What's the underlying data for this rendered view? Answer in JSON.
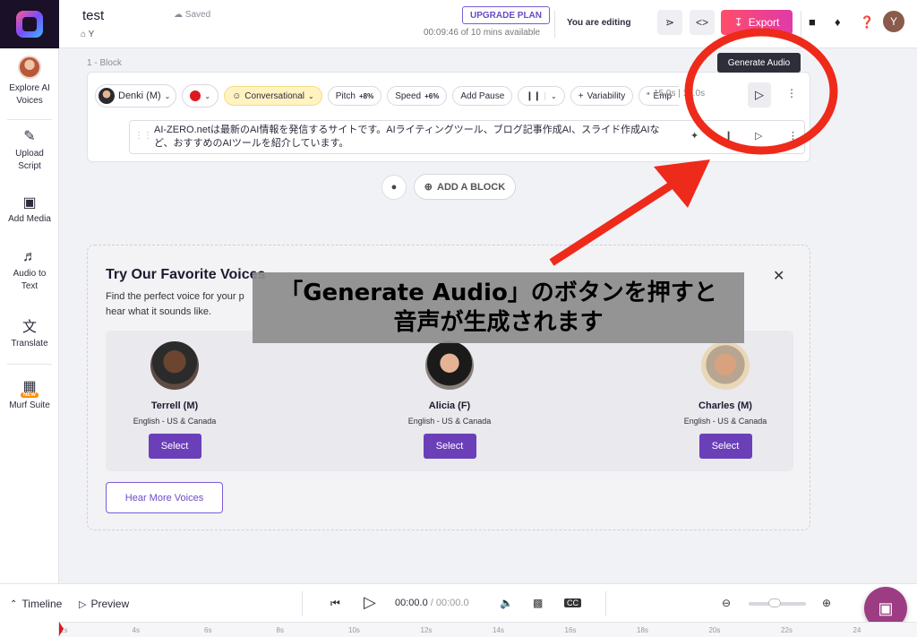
{
  "app": {
    "project_title": "test",
    "saved_status": "Saved",
    "breadcrumb": "Y",
    "upgrade_label": "UPGRADE PLAN",
    "time_available": "00:09:46 of 10 mins available",
    "editing_status": "You are editing",
    "export_label": "Export",
    "user_initial": "Y"
  },
  "sidebar": {
    "items": [
      {
        "label": "Explore AI Voices",
        "icon": "avatar"
      },
      {
        "label": "Upload Script",
        "icon": "upload-icon"
      },
      {
        "label": "Add Media",
        "icon": "media-icon"
      },
      {
        "label": "Audio to Text",
        "icon": "audio-text-icon"
      },
      {
        "label": "Translate",
        "icon": "translate-icon"
      },
      {
        "label": "Murf Suite",
        "icon": "grid-icon",
        "badge": "NEW"
      }
    ]
  },
  "block": {
    "label": "1 - Block",
    "voice_name": "Denki (M)",
    "style": "Conversational",
    "pitch_label": "Pitch",
    "pitch_value": "+8%",
    "speed_label": "Speed",
    "speed_value": "+6%",
    "add_pause": "Add Pause",
    "variability": "Variability",
    "emphasis": "Emp",
    "duration_a": "15.0s",
    "duration_b": "15.0s",
    "script_text": "AI-ZERO.netは最新のAI情報を発信するサイトです。AIライティングツール、ブログ記事作成AI、スライド作成AIなど、おすすめのAIツールを紹介しています。",
    "tooltip": "Generate Audio"
  },
  "add_block_label": "ADD A BLOCK",
  "favorites": {
    "title": "Try Our Favorite Voices",
    "description": "Find the perfect voice for your p hear what it sounds like.",
    "voices": [
      {
        "name": "Terrell (M)",
        "lang": "English - US & Canada",
        "select": "Select"
      },
      {
        "name": "Alicia (F)",
        "lang": "English - US & Canada",
        "select": "Select"
      },
      {
        "name": "Charles (M)",
        "lang": "English - US & Canada",
        "select": "Select"
      }
    ],
    "hear_more": "Hear More Voices"
  },
  "caption": {
    "line1": "「Generate Audio」のボタンを押すと",
    "line2": "音声が生成されます"
  },
  "bottom": {
    "timeline": "Timeline",
    "preview": "Preview",
    "current_time": "00:00.0",
    "total_time": "00:00.0",
    "ruler_ticks": [
      "2s",
      "4s",
      "6s",
      "8s",
      "10s",
      "12s",
      "14s",
      "16s",
      "18s",
      "20s",
      "22s",
      "24"
    ]
  },
  "colors": {
    "accent_purple": "#6b3fb8",
    "export_gradient_start": "#ff4d6a",
    "annotation_red": "#ee2a1b"
  }
}
